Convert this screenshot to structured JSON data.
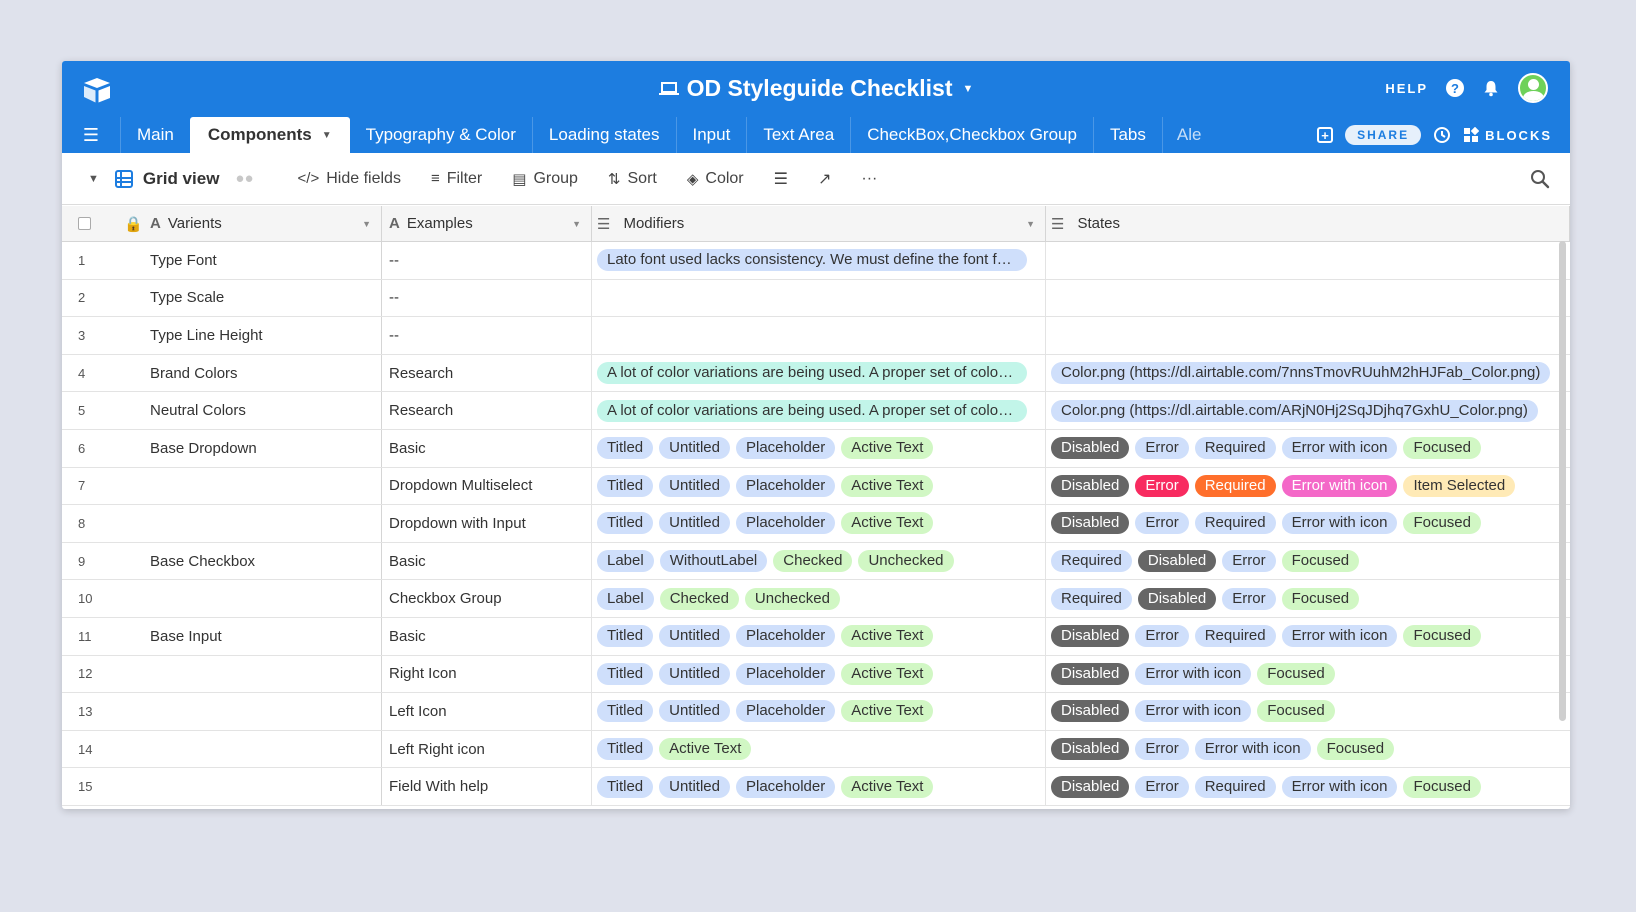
{
  "header": {
    "title": "OD Styleguide Checklist",
    "help_label": "HELP"
  },
  "tabs": [
    "Main",
    "Components",
    "Typography & Color",
    "Loading states",
    "Input",
    "Text Area",
    "CheckBox,Checkbox Group",
    "Tabs",
    "Ale"
  ],
  "active_tab": 1,
  "tab_tools": {
    "share_label": "SHARE",
    "blocks_label": "BLOCKS"
  },
  "viewbar": {
    "view_name": "Grid view",
    "hide_fields": "Hide fields",
    "filter": "Filter",
    "group": "Group",
    "sort": "Sort",
    "color": "Color"
  },
  "columns": [
    "Varients",
    "Examples",
    "Modifiers",
    "States"
  ],
  "colors": {
    "brand": "#1d7de0",
    "blue": "#cfdffb",
    "teal": "#c2f5e9",
    "green": "#d1f7c4",
    "gray": "#666666",
    "red": "#f82b60",
    "orange": "#ff6f2c",
    "pink": "#f468c8",
    "yellow": "#ffeab6"
  },
  "rows": [
    {
      "num": "1",
      "varient": "Type Font",
      "example": "--",
      "modifiers": [
        [
          "Lato font used lacks consistency. We must define the font family being used throughout the application.",
          "blue",
          "wide"
        ]
      ],
      "states": []
    },
    {
      "num": "2",
      "varient": "Type Scale",
      "example": "--",
      "modifiers": [],
      "states": []
    },
    {
      "num": "3",
      "varient": "Type Line Height",
      "example": "--",
      "modifiers": [],
      "states": []
    },
    {
      "num": "4",
      "varient": "Brand Colors",
      "example": "Research",
      "modifiers": [
        [
          "A lot of color variations are being used. A proper set of colors has to be defined for the system.",
          "teal",
          "wide"
        ]
      ],
      "states": [
        [
          "Color.png (https://dl.airtable.com/7nnsTmovRUuhM2hHJFab_Color.png)",
          "blue",
          "link"
        ]
      ]
    },
    {
      "num": "5",
      "varient": "Neutral Colors",
      "example": "Research",
      "modifiers": [
        [
          "A lot of color variations are being used. A proper set of colors has to be defined for the system.",
          "teal",
          "wide"
        ]
      ],
      "states": [
        [
          "Color.png (https://dl.airtable.com/ARjN0Hj2SqJDjhq7GxhU_Color.png)",
          "blue",
          "link"
        ]
      ]
    },
    {
      "num": "6",
      "varient": "Base Dropdown",
      "example": "Basic",
      "modifiers": [
        [
          "Titled",
          "blue"
        ],
        [
          "Untitled",
          "blue"
        ],
        [
          "Placeholder",
          "blue"
        ],
        [
          "Active Text",
          "green"
        ]
      ],
      "states": [
        [
          "Disabled",
          "gray"
        ],
        [
          "Error",
          "blue"
        ],
        [
          "Required",
          "blue"
        ],
        [
          "Error with icon",
          "blue"
        ],
        [
          "Focused",
          "green"
        ]
      ]
    },
    {
      "num": "7",
      "varient": "",
      "example": "Dropdown Multiselect",
      "modifiers": [
        [
          "Titled",
          "blue"
        ],
        [
          "Untitled",
          "blue"
        ],
        [
          "Placeholder",
          "blue"
        ],
        [
          "Active Text",
          "green"
        ]
      ],
      "states": [
        [
          "Disabled",
          "gray"
        ],
        [
          "Error",
          "red"
        ],
        [
          "Required",
          "orange"
        ],
        [
          "Error with icon",
          "pink"
        ],
        [
          "Item Selected",
          "yellow"
        ]
      ]
    },
    {
      "num": "8",
      "varient": "",
      "example": "Dropdown with Input",
      "modifiers": [
        [
          "Titled",
          "blue"
        ],
        [
          "Untitled",
          "blue"
        ],
        [
          "Placeholder",
          "blue"
        ],
        [
          "Active Text",
          "green"
        ]
      ],
      "states": [
        [
          "Disabled",
          "gray"
        ],
        [
          "Error",
          "blue"
        ],
        [
          "Required",
          "blue"
        ],
        [
          "Error with icon",
          "blue"
        ],
        [
          "Focused",
          "green"
        ]
      ]
    },
    {
      "num": "9",
      "varient": "Base Checkbox",
      "example": "Basic",
      "modifiers": [
        [
          "Label",
          "blue"
        ],
        [
          "WithoutLabel",
          "blue"
        ],
        [
          "Checked",
          "green"
        ],
        [
          "Unchecked",
          "green"
        ]
      ],
      "states": [
        [
          "Required",
          "blue"
        ],
        [
          "Disabled",
          "gray"
        ],
        [
          "Error",
          "blue"
        ],
        [
          "Focused",
          "green"
        ]
      ]
    },
    {
      "num": "10",
      "varient": "",
      "example": "Checkbox Group",
      "modifiers": [
        [
          "Label",
          "blue"
        ],
        [
          "Checked",
          "green"
        ],
        [
          "Unchecked",
          "green"
        ]
      ],
      "states": [
        [
          "Required",
          "blue"
        ],
        [
          "Disabled",
          "gray"
        ],
        [
          "Error",
          "blue"
        ],
        [
          "Focused",
          "green"
        ]
      ]
    },
    {
      "num": "11",
      "varient": "Base Input",
      "example": "Basic",
      "modifiers": [
        [
          "Titled",
          "blue"
        ],
        [
          "Untitled",
          "blue"
        ],
        [
          "Placeholder",
          "blue"
        ],
        [
          "Active Text",
          "green"
        ]
      ],
      "states": [
        [
          "Disabled",
          "gray"
        ],
        [
          "Error",
          "blue"
        ],
        [
          "Required",
          "blue"
        ],
        [
          "Error with icon",
          "blue"
        ],
        [
          "Focused",
          "green"
        ]
      ]
    },
    {
      "num": "12",
      "varient": "",
      "example": "Right Icon",
      "modifiers": [
        [
          "Titled",
          "blue"
        ],
        [
          "Untitled",
          "blue"
        ],
        [
          "Placeholder",
          "blue"
        ],
        [
          "Active Text",
          "green"
        ]
      ],
      "states": [
        [
          "Disabled",
          "gray"
        ],
        [
          "Error with icon",
          "blue"
        ],
        [
          "Focused",
          "green"
        ]
      ]
    },
    {
      "num": "13",
      "varient": "",
      "example": "Left Icon",
      "modifiers": [
        [
          "Titled",
          "blue"
        ],
        [
          "Untitled",
          "blue"
        ],
        [
          "Placeholder",
          "blue"
        ],
        [
          "Active Text",
          "green"
        ]
      ],
      "states": [
        [
          "Disabled",
          "gray"
        ],
        [
          "Error with icon",
          "blue"
        ],
        [
          "Focused",
          "green"
        ]
      ]
    },
    {
      "num": "14",
      "varient": "",
      "example": "Left Right icon",
      "modifiers": [
        [
          "Titled",
          "blue"
        ],
        [
          "Active Text",
          "green"
        ]
      ],
      "states": [
        [
          "Disabled",
          "gray"
        ],
        [
          "Error",
          "blue"
        ],
        [
          "Error with icon",
          "blue"
        ],
        [
          "Focused",
          "green"
        ]
      ]
    },
    {
      "num": "15",
      "varient": "",
      "example": "Field With help",
      "modifiers": [
        [
          "Titled",
          "blue"
        ],
        [
          "Untitled",
          "blue"
        ],
        [
          "Placeholder",
          "blue"
        ],
        [
          "Active Text",
          "green"
        ]
      ],
      "states": [
        [
          "Disabled",
          "gray"
        ],
        [
          "Error",
          "blue"
        ],
        [
          "Required",
          "blue"
        ],
        [
          "Error with icon",
          "blue"
        ],
        [
          "Focused",
          "green"
        ]
      ]
    }
  ]
}
